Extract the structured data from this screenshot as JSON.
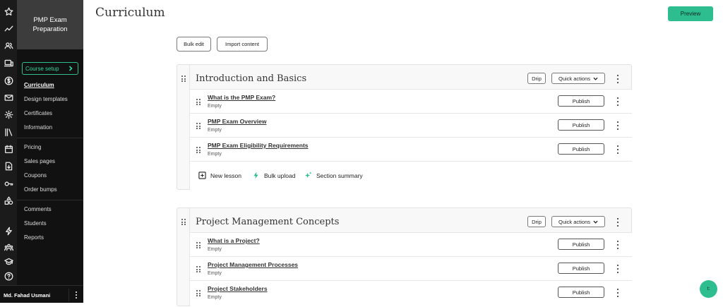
{
  "page": {
    "title": "Curriculum"
  },
  "header": {
    "preview_label": "Preview"
  },
  "toolbar": {
    "bulk_edit_label": "Bulk edit",
    "import_content_label": "Import content"
  },
  "sidebar": {
    "course_title": "PMP Exam Preparation",
    "setup_label": "Course setup",
    "items": [
      "Curriculum",
      "Design templates",
      "Certificates",
      "Information",
      "Pricing",
      "Sales pages",
      "Coupons",
      "Order bumps",
      "Comments",
      "Students",
      "Reports"
    ],
    "active_item": "Curriculum",
    "user_name": "Md. Fahad Usmani"
  },
  "rail_icons": [
    "star-icon",
    "trend-icon",
    "users-icon",
    "devices-icon",
    "dollar-icon",
    "mail-icon",
    "gear-icon",
    "library-icon",
    "calendar-icon",
    "download-icon",
    "key-icon",
    "shapes-icon",
    "bolt-icon",
    "community-icon",
    "graduation-icon",
    "help-icon"
  ],
  "sections": [
    {
      "title": "Introduction and Basics",
      "drip_label": "Drip",
      "quick_actions_label": "Quick actions",
      "lessons": [
        {
          "title": "What is the PMP Exam?",
          "status": "Empty",
          "action": "Publish"
        },
        {
          "title": "PMP Exam Overview",
          "status": "Empty",
          "action": "Publish"
        },
        {
          "title": "PMP Exam Eligibility Requirements",
          "status": "Empty",
          "action": "Publish"
        }
      ],
      "footer": {
        "new_lesson": "New lesson",
        "bulk_upload": "Bulk upload",
        "section_summary": "Section summary"
      }
    },
    {
      "title": "Project Management Concepts",
      "drip_label": "Drip",
      "quick_actions_label": "Quick actions",
      "lessons": [
        {
          "title": "What is a Project?",
          "status": "Empty",
          "action": "Publish"
        },
        {
          "title": "Project Management Processes",
          "status": "Empty",
          "action": "Publish"
        },
        {
          "title": "Project Stakeholders",
          "status": "Empty",
          "action": "Publish"
        }
      ]
    }
  ],
  "chat": {
    "label": "t:"
  },
  "colors": {
    "accent": "#2dbd8f",
    "sidebar_bg": "#111111",
    "rail_bg": "#1b1b1b"
  }
}
